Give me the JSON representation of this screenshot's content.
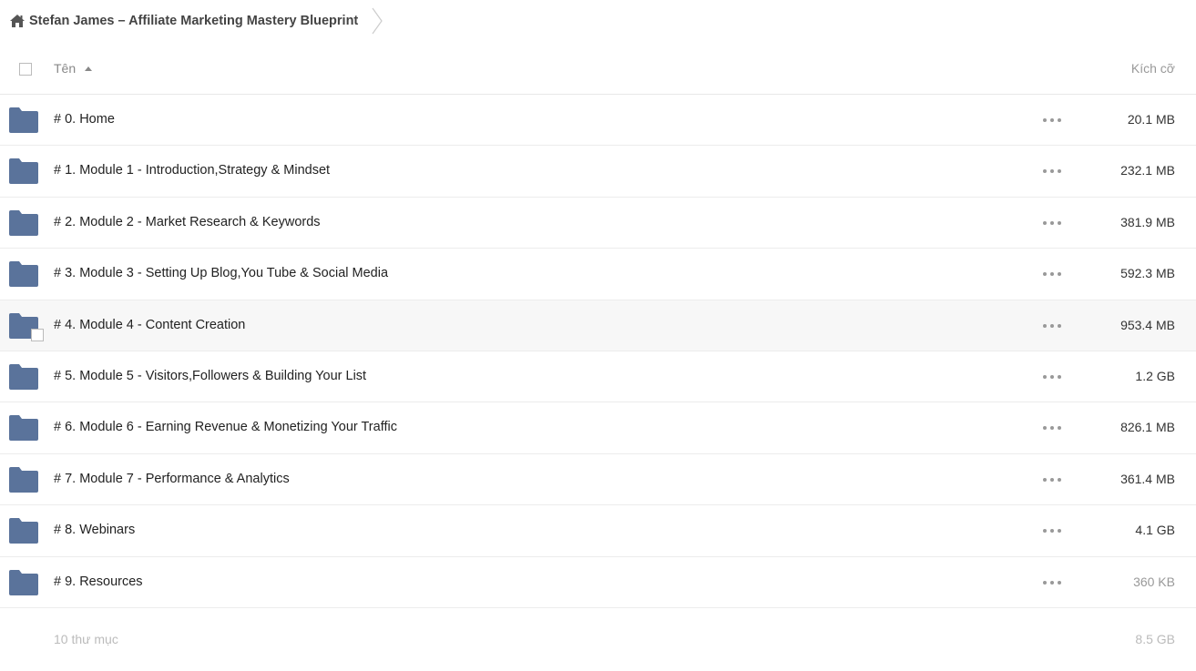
{
  "breadcrumb": {
    "home_icon": "home-icon",
    "title": "Stefan James – Affiliate Marketing Mastery Blueprint"
  },
  "header": {
    "name_label": "Tên",
    "size_label": "Kích cỡ",
    "sort_icon": "sort-ascending-icon"
  },
  "colors": {
    "folder": "#5a739b",
    "row_hover": "#f7f7f7",
    "muted_text": "#999999"
  },
  "items": [
    {
      "name": "# 0. Home",
      "size": "20.1 MB"
    },
    {
      "name": "# 1. Module 1 - Introduction,Strategy & Mindset",
      "size": "232.1 MB"
    },
    {
      "name": "# 2. Module 2 - Market Research & Keywords",
      "size": "381.9 MB"
    },
    {
      "name": "# 3. Module 3 - Setting Up Blog,You Tube & Social Media",
      "size": "592.3 MB"
    },
    {
      "name": "# 4. Module 4 - Content Creation",
      "size": "953.4 MB"
    },
    {
      "name": "# 5. Module 5 - Visitors,Followers & Building Your List",
      "size": "1.2 GB"
    },
    {
      "name": "# 6. Module 6 - Earning Revenue & Monetizing Your Traffic",
      "size": "826.1 MB"
    },
    {
      "name": "# 7. Module 7 - Performance & Analytics",
      "size": "361.4 MB"
    },
    {
      "name": "# 8. Webinars",
      "size": "4.1 GB"
    },
    {
      "name": "# 9. Resources",
      "size": "360 KB"
    }
  ],
  "summary": {
    "count": "10 thư mục",
    "total_size": "8.5 GB"
  }
}
